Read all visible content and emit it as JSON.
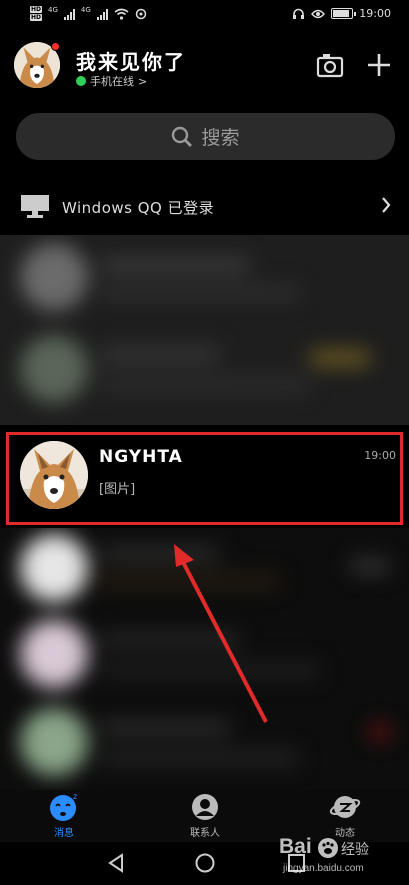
{
  "status_bar": {
    "hd_badge": "HD",
    "network_label": "4G",
    "time": "19:00"
  },
  "header": {
    "nickname": "我来见你了",
    "online_status": "手机在线",
    "online_chevron": ">"
  },
  "search": {
    "placeholder": "搜索"
  },
  "pc_login": {
    "label": "Windows QQ 已登录"
  },
  "chat": {
    "name": "NGYHTA",
    "time": "19:00",
    "last_message": "[图片]"
  },
  "tabs": [
    {
      "label": "消息",
      "icon": "chat-bubble-icon",
      "active": true
    },
    {
      "label": "联系人",
      "icon": "contacts-icon",
      "active": false
    },
    {
      "label": "动态",
      "icon": "planet-icon",
      "active": false
    }
  ],
  "watermark": {
    "logo": "Bai",
    "word": "经验",
    "url": "jingyan.baidu.com"
  },
  "colors": {
    "accent": "#2b8cff",
    "highlight_border": "#e12b2b",
    "online_green": "#2fd05a",
    "badge_red": "#ff2d2d"
  }
}
